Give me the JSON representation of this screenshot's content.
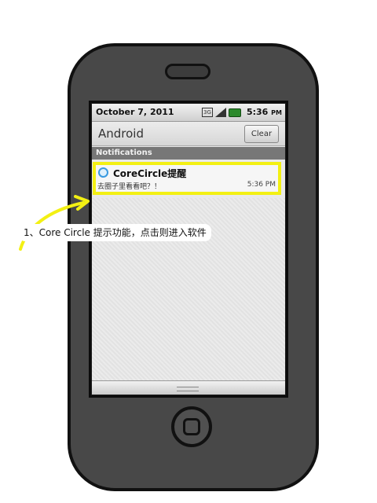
{
  "status_bar": {
    "date": "October 7, 2011",
    "time": "5:36",
    "time_suffix": "PM",
    "net_label": "3G",
    "icons": [
      "network-3g-icon",
      "signal-icon",
      "battery-icon"
    ]
  },
  "header": {
    "title": "Android",
    "clear_label": "Clear"
  },
  "section": {
    "label": "Notifications"
  },
  "notification": {
    "icon": "corecircle-icon",
    "title": "CoreCircle提醒",
    "message": "去圈子里看看吧？！",
    "time": "5:36 PM"
  },
  "callout": {
    "text": "1、Core Circle 提示功能，点击则进入软件"
  },
  "colors": {
    "phone_body": "#484848",
    "highlight": "#f3f013",
    "section_bar": "#777777"
  }
}
